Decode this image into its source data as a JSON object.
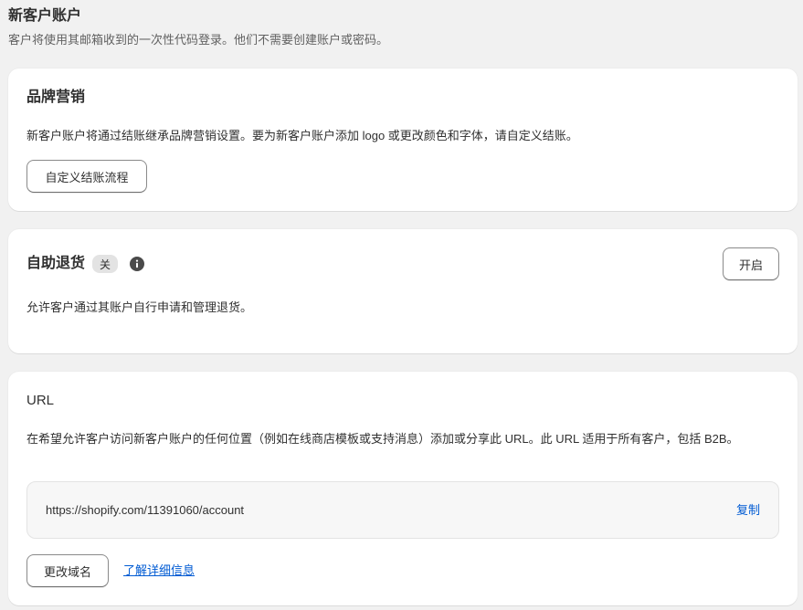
{
  "header": {
    "title": "新客户账户",
    "description": "客户将使用其邮箱收到的一次性代码登录。他们不需要创建账户或密码。"
  },
  "branding": {
    "title": "品牌营销",
    "description": "新客户账户将通过结账继承品牌营销设置。要为新客户账户添加 logo 或更改颜色和字体，请自定义结账。",
    "customize_button": "自定义结账流程"
  },
  "self_returns": {
    "title": "自助退货",
    "status_badge": "关",
    "info_icon": "info-icon",
    "enable_button": "开启",
    "description": "允许客户通过其账户自行申请和管理退货。"
  },
  "url_section": {
    "title": "URL",
    "description": "在希望允许客户访问新客户账户的任何位置（例如在线商店模板或支持消息）添加或分享此 URL。此 URL 适用于所有客户，包括 B2B。",
    "url": "https://shopify.com/11391060/account",
    "copy_label": "复制",
    "change_domain_button": "更改域名",
    "learn_more_link": "了解详细信息"
  },
  "colors": {
    "link": "#005bd3",
    "page_background": "#f1f1f1",
    "card_background": "#ffffff",
    "badge_background": "#e3e3e3"
  }
}
